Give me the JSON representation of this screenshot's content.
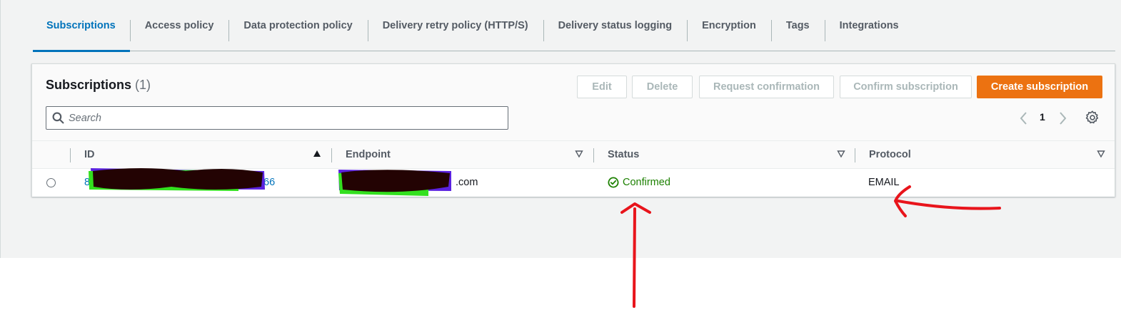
{
  "tabs": [
    {
      "label": "Subscriptions",
      "active": true
    },
    {
      "label": "Access policy"
    },
    {
      "label": "Data protection policy"
    },
    {
      "label": "Delivery retry policy (HTTP/S)"
    },
    {
      "label": "Delivery status logging"
    },
    {
      "label": "Encryption"
    },
    {
      "label": "Tags"
    },
    {
      "label": "Integrations"
    }
  ],
  "panel": {
    "title": "Subscriptions",
    "count": "(1)"
  },
  "actions": {
    "edit": "Edit",
    "delete": "Delete",
    "request_confirmation": "Request confirmation",
    "confirm_subscription": "Confirm subscription",
    "create_subscription": "Create subscription"
  },
  "search": {
    "placeholder": "Search"
  },
  "pagination": {
    "current_page": "1"
  },
  "table": {
    "columns": [
      "ID",
      "Endpoint",
      "Status",
      "Protocol"
    ],
    "rows": [
      {
        "id_visible_start": "8",
        "id_visible_end": "66",
        "endpoint_visible_end": ".com",
        "status": "Confirmed",
        "protocol": "EMAIL"
      }
    ]
  },
  "colors": {
    "accent_blue": "#0073bb",
    "primary_orange": "#ec7211",
    "success_green": "#1d8102",
    "annotation_red": "#e8141b"
  }
}
